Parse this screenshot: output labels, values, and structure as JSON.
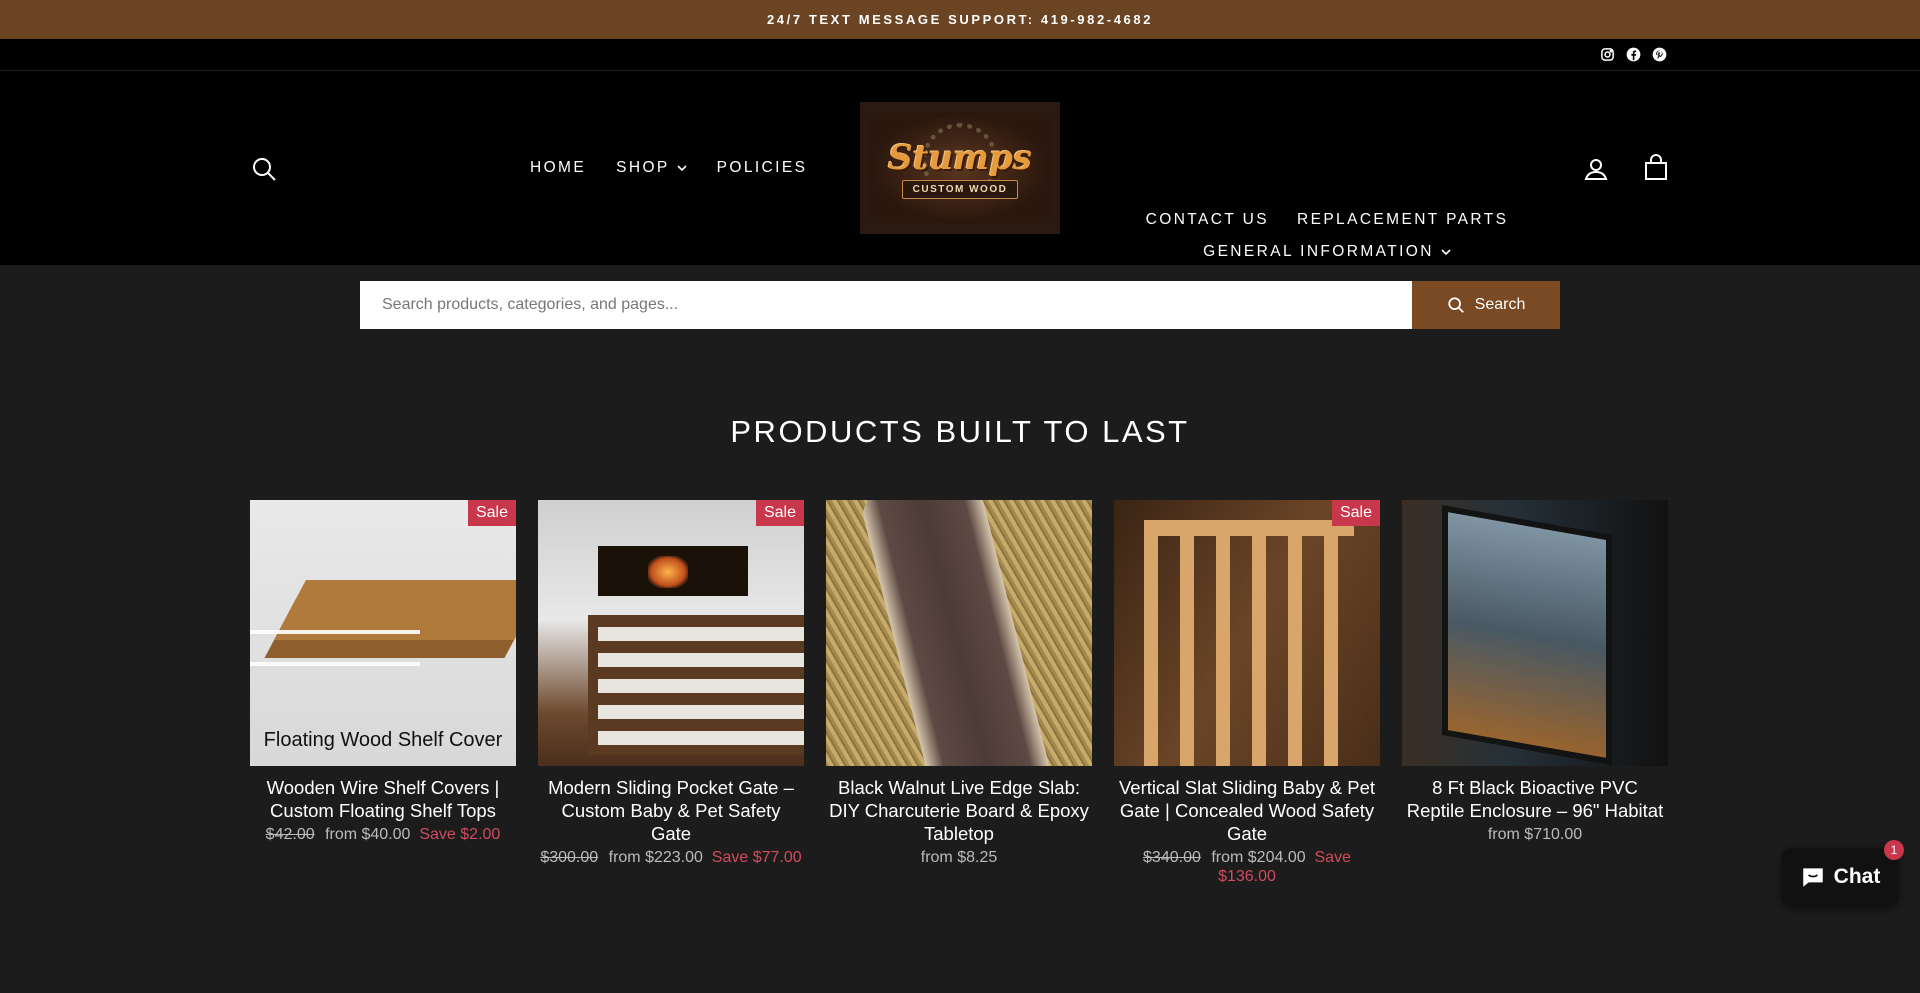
{
  "announcement": "24/7 TEXT MESSAGE SUPPORT: 419-982-4682",
  "social": [
    "instagram-icon",
    "facebook-icon",
    "pinterest-icon"
  ],
  "nav": {
    "left": [
      {
        "label": "HOME"
      },
      {
        "label": "SHOP",
        "dropdown": true
      },
      {
        "label": "POLICIES"
      }
    ],
    "right": [
      {
        "label": "CONTACT US"
      },
      {
        "label": "REPLACEMENT PARTS"
      },
      {
        "label": "GENERAL INFORMATION",
        "dropdown": true
      }
    ]
  },
  "logo": {
    "main": "Stumps",
    "sub": "CUSTOM WOOD"
  },
  "search": {
    "placeholder": "Search products, categories, and pages...",
    "button": "Search"
  },
  "section_title": "PRODUCTS BUILT TO LAST",
  "products": [
    {
      "title": "Wooden Wire Shelf Covers | Custom Floating Shelf Tops",
      "badge": "Sale",
      "image_caption": "Floating Wood Shelf Cover",
      "old_price": "$42.00",
      "price": "from $40.00",
      "save_label": "Save",
      "save_amount": "$2.00"
    },
    {
      "title": "Modern Sliding Pocket Gate – Custom Baby & Pet Safety Gate",
      "badge": "Sale",
      "old_price": "$300.00",
      "price": "from $223.00",
      "save_label": "Save",
      "save_amount": "$77.00"
    },
    {
      "title": "Black Walnut Live Edge Slab: DIY Charcuterie Board & Epoxy Tabletop",
      "badge": "",
      "price": "from $8.25"
    },
    {
      "title": "Vertical Slat Sliding Baby & Pet Gate | Concealed Wood Safety Gate",
      "badge": "Sale",
      "old_price": "$340.00",
      "price": "from $204.00",
      "save_label": "Save",
      "save_amount": "$136.00"
    },
    {
      "title": "8 Ft Black Bioactive PVC Reptile Enclosure – 96\" Habitat",
      "badge": "",
      "price": "from $710.00"
    }
  ],
  "chat": {
    "label": "Chat",
    "badge": "1"
  },
  "colors": {
    "announce_bg": "#6b4423",
    "search_button": "#7a4a24",
    "sale_badge": "#c8374c",
    "save_text": "#d04b5e"
  }
}
